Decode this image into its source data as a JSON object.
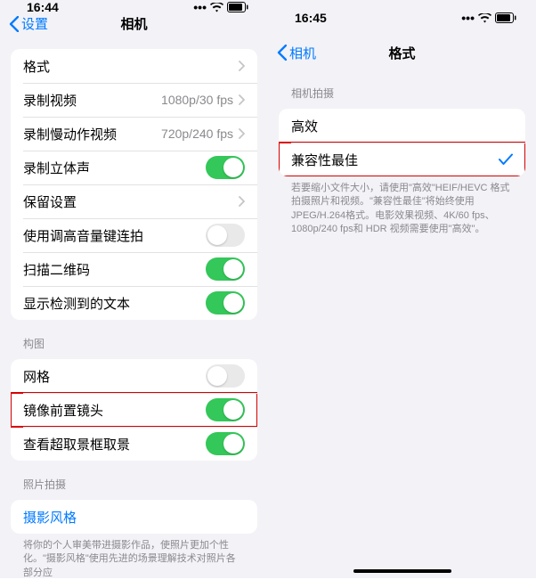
{
  "left": {
    "time": "16:44",
    "back": "设置",
    "title": "相机",
    "group1": [
      {
        "label": "格式",
        "type": "disclosure"
      },
      {
        "label": "录制视频",
        "value": "1080p/30 fps",
        "type": "disclosure"
      },
      {
        "label": "录制慢动作视频",
        "value": "720p/240 fps",
        "type": "disclosure"
      },
      {
        "label": "录制立体声",
        "type": "toggle",
        "on": true
      },
      {
        "label": "保留设置",
        "type": "disclosure"
      },
      {
        "label": "使用调高音量键连拍",
        "type": "toggle",
        "on": false
      },
      {
        "label": "扫描二维码",
        "type": "toggle",
        "on": true
      },
      {
        "label": "显示检测到的文本",
        "type": "toggle",
        "on": true
      }
    ],
    "group2_header": "构图",
    "group2": [
      {
        "label": "网格",
        "type": "toggle",
        "on": false
      },
      {
        "label": "镜像前置镜头",
        "type": "toggle",
        "on": true,
        "highlight": true
      },
      {
        "label": "查看超取景框取景",
        "type": "toggle",
        "on": true
      }
    ],
    "group3_header": "照片拍摄",
    "group3": [
      {
        "label": "摄影风格",
        "type": "link"
      }
    ],
    "group3_footer": "将你的个人审美带进摄影作品，使照片更加个性化。\"摄影风格\"使用先进的场景理解技术对照片各部分应"
  },
  "right": {
    "time": "16:45",
    "back": "相机",
    "title": "格式",
    "header": "相机拍摄",
    "items": [
      {
        "label": "高效",
        "checked": false
      },
      {
        "label": "兼容性最佳",
        "checked": true,
        "highlight": true
      }
    ],
    "footer": "若要缩小文件大小，请使用\"高效\"HEIF/HEVC 格式拍摄照片和视频。\"兼容性最佳\"将始终使用 JPEG/H.264格式。电影效果视频、4K/60 fps、1080p/240 fps和 HDR 视频需要使用\"高效\"。"
  }
}
